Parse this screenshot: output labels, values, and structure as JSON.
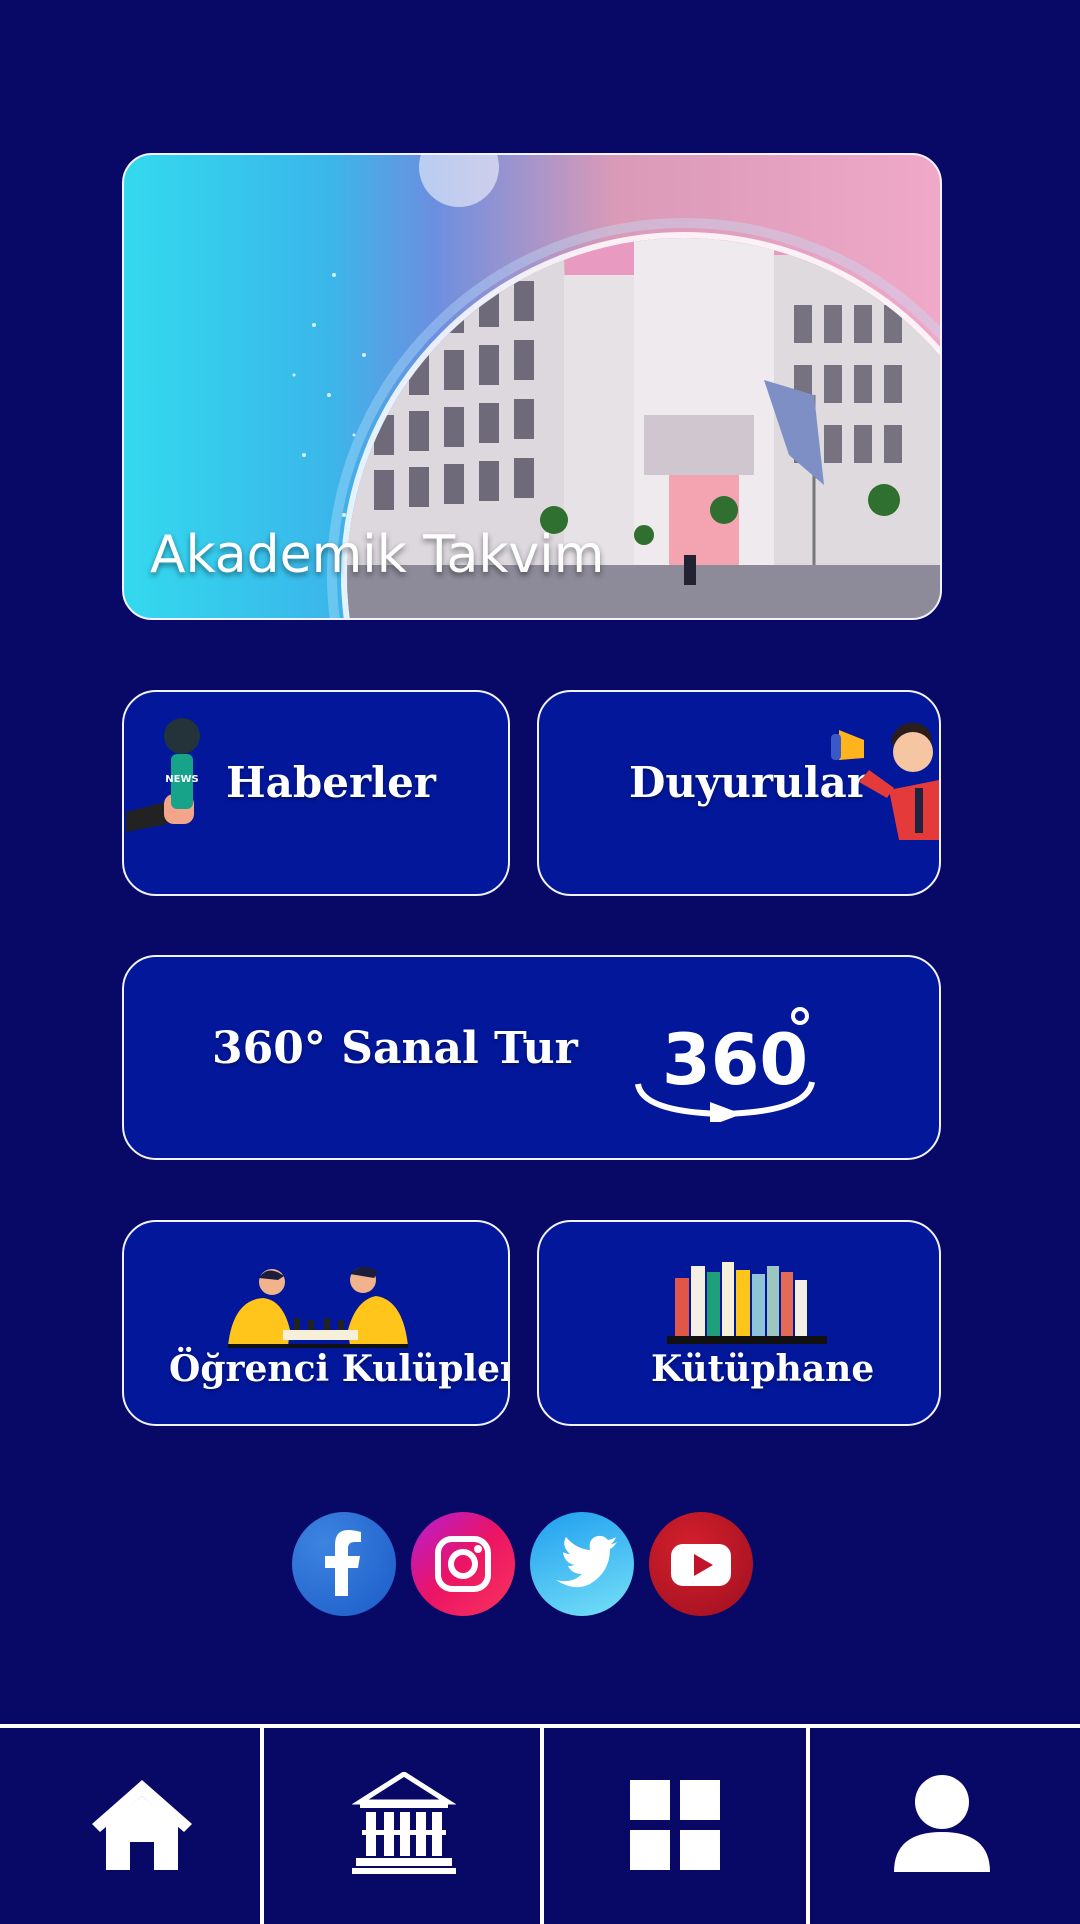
{
  "hero": {
    "title": "Akademik Takvim"
  },
  "tiles": {
    "news": "Haberler",
    "announcements": "Duyurular",
    "virtual_tour": "360° Sanal Tur",
    "virtual_tour_badge": "360",
    "clubs": "Öğrenci Kulüpleri",
    "library": "Kütüphane",
    "news_badge": "NEWS"
  },
  "social": [
    "facebook",
    "instagram",
    "twitter",
    "youtube"
  ],
  "bottom_nav": [
    "home",
    "campus",
    "menu-grid",
    "profile"
  ],
  "colors": {
    "background": "#080866",
    "tile": "#03179b",
    "facebook": "#2b6fd6",
    "instagram": "#d4138f",
    "twitter": "#3bb8f2",
    "youtube": "#c2132a"
  }
}
